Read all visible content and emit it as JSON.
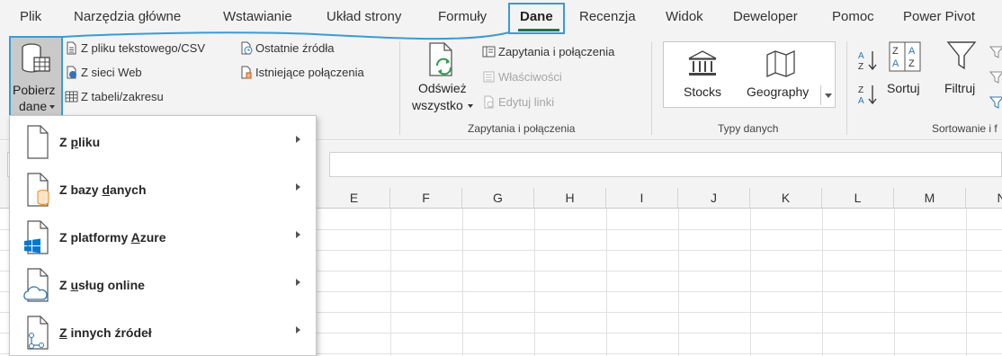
{
  "tabs": [
    "Plik",
    "Narzędzia główne",
    "Wstawianie",
    "Układ strony",
    "Formuły",
    "Dane",
    "Recenzja",
    "Widok",
    "Deweloper",
    "Pomoc",
    "Power Pivot"
  ],
  "active_tab": "Dane",
  "get_data": {
    "line1": "Pobierz",
    "line2": "dane"
  },
  "get_transform": {
    "from_text_csv": "Z pliku tekstowego/CSV",
    "from_web": "Z sieci Web",
    "from_table": "Z tabeli/zakresu",
    "recent_sources": "Ostatnie źródła",
    "existing_connections": "Istniejące połączenia"
  },
  "queries": {
    "refresh_all_line1": "Odśwież",
    "refresh_all_line2": "wszystko",
    "queries_connections": "Zapytania i połączenia",
    "properties": "Właściwości",
    "edit_links": "Edytuj linki",
    "group_label": "Zapytania i połączenia"
  },
  "data_types": {
    "stocks": "Stocks",
    "geography": "Geography",
    "group_label": "Typy danych"
  },
  "sort_filter": {
    "sort": "Sortuj",
    "filter": "Filtruj",
    "group_label": "Sortowanie i f"
  },
  "columns": [
    "E",
    "F",
    "G",
    "H",
    "I",
    "J",
    "K",
    "L",
    "M",
    "N"
  ],
  "menu": [
    {
      "pre": "Z ",
      "key": "p",
      "post": "liku"
    },
    {
      "pre": "Z bazy ",
      "key": "d",
      "post": "anych"
    },
    {
      "pre": "Z platformy ",
      "key": "A",
      "post": "zure"
    },
    {
      "pre": "Z ",
      "key": "u",
      "post": "sług online"
    },
    {
      "pre": "",
      "key": "Z",
      "post": " innych źródeł"
    }
  ],
  "colors": {
    "accent_green": "#217346",
    "highlight_blue": "#3a9bd5",
    "azure_blue": "#0078d4"
  }
}
